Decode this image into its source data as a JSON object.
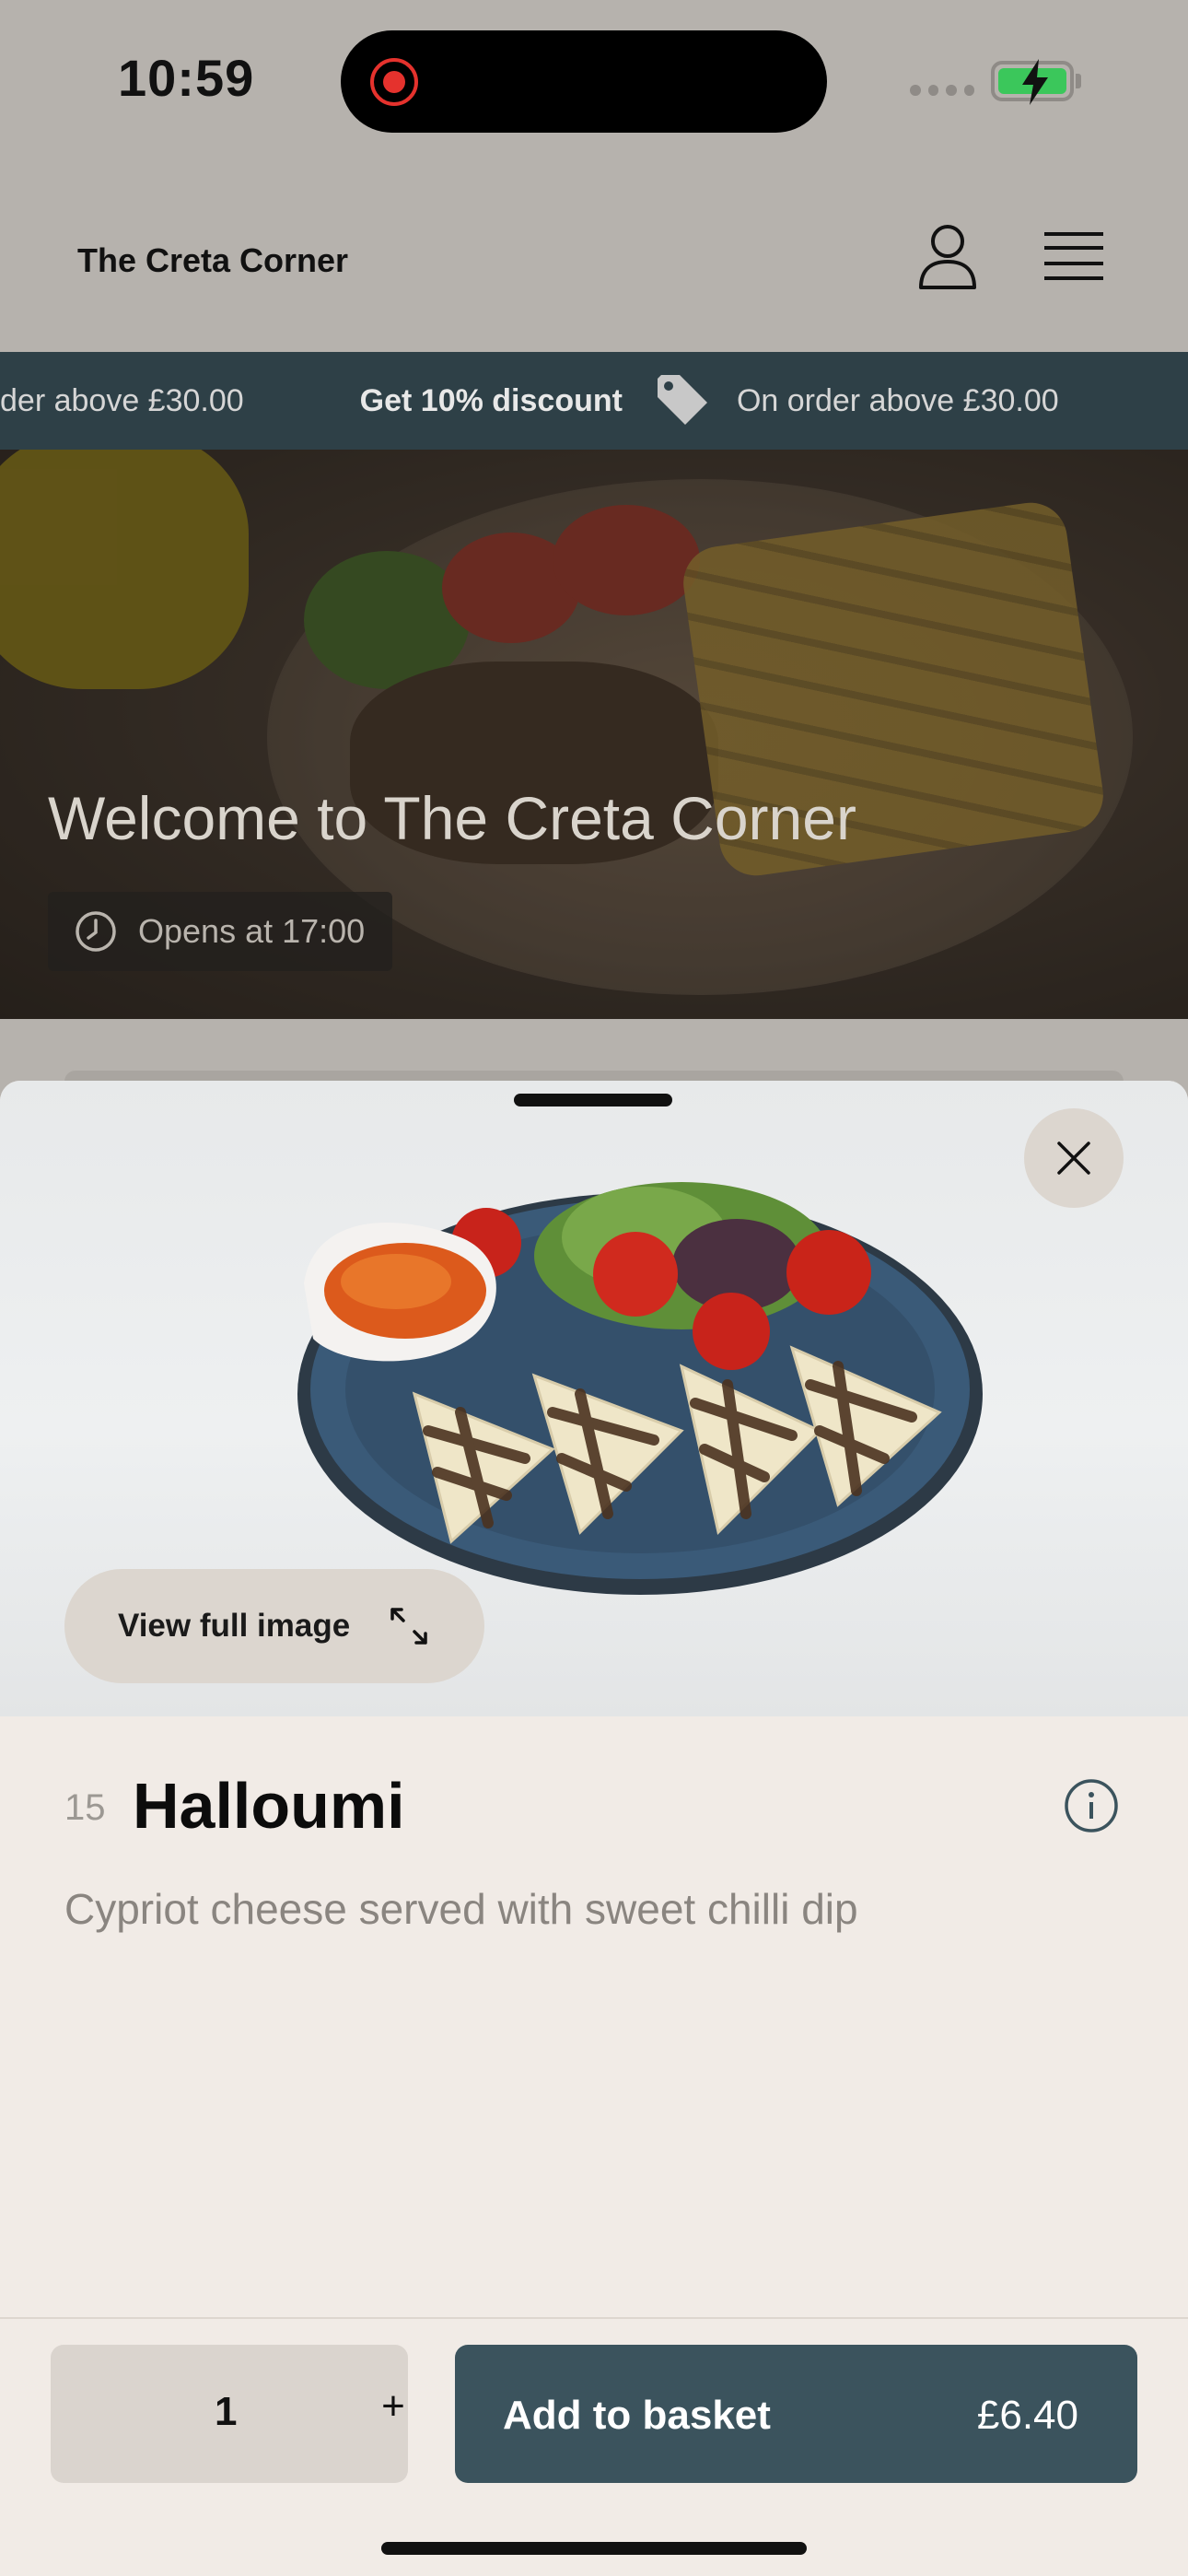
{
  "status_bar": {
    "time": "10:59"
  },
  "header": {
    "brand": "The Creta Corner"
  },
  "promo": {
    "items": [
      {
        "text": "der above £30.00"
      },
      {
        "strong": "Get 10% discount"
      },
      {
        "text": "On order above £30.00"
      }
    ]
  },
  "hero": {
    "title": "Welcome to The Creta Corner",
    "opens": "Opens at 17:00"
  },
  "sheet": {
    "view_full_image": "View full image",
    "item": {
      "number": "15",
      "name": "Halloumi",
      "description": "Cypriot cheese served with sweet chilli dip"
    },
    "quantity": "1",
    "plus": "+",
    "add_to_basket": "Add to basket",
    "price": "£6.40"
  },
  "colors": {
    "accent": "#3b535d",
    "promo_bg": "#2e4047",
    "sheet_bg": "#f1ebe6",
    "battery": "#3bc75b",
    "recording": "#e5322d"
  },
  "icons": [
    "user-icon",
    "hamburger-menu-icon",
    "tag-icon",
    "clock-icon",
    "close-icon",
    "expand-icon",
    "info-icon"
  ]
}
